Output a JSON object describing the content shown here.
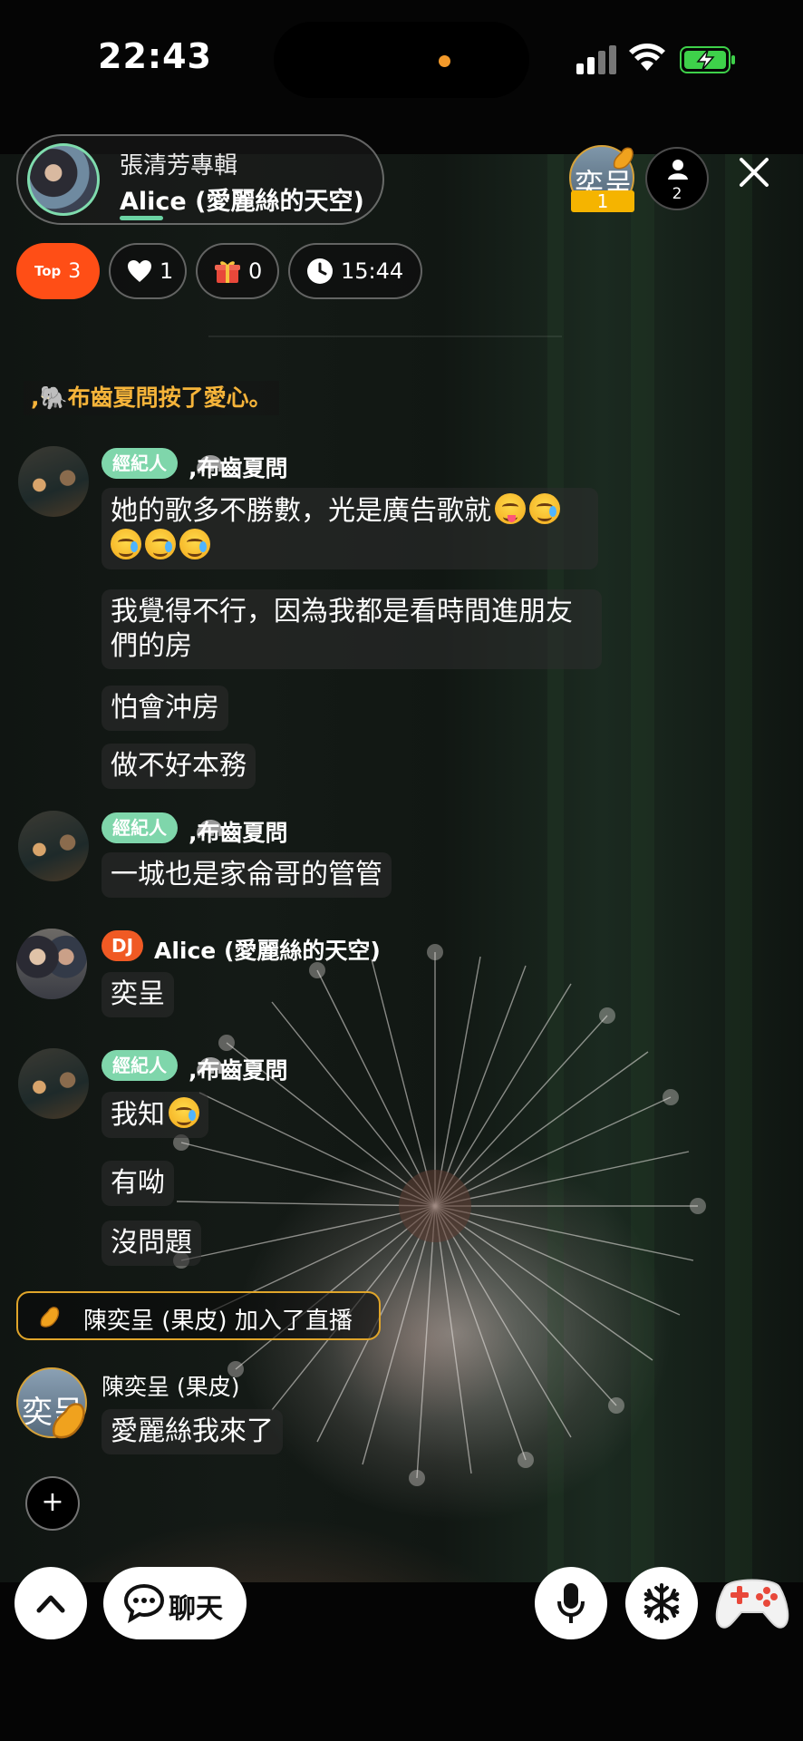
{
  "status_bar": {
    "time": "22:43"
  },
  "host": {
    "title": "張清芳專輯",
    "name": "Alice (愛麗絲的天空)"
  },
  "top_right": {
    "rank_badge_char": "奕呈",
    "rank_number": "1",
    "viewer_count": "2"
  },
  "stats": {
    "top_label": "Top",
    "top_value": "3",
    "likes": "1",
    "gifts": "0",
    "duration": "15:44"
  },
  "chat": {
    "system_like": ",🐘布齒夏問按了愛心。",
    "agent_tag": "經紀人",
    "dj_tag": "DJ",
    "agent_name": ",布齒夏問",
    "host_name": "Alice (愛麗絲的天空)",
    "msg1": "她的歌多不勝數，光是廣告歌就",
    "msg2": "我覺得不行，因為我都是看時間進朋友們的房",
    "msg3": "怕會沖房",
    "msg4": "做不好本務",
    "msg5": "一城也是家侖哥的管管",
    "msg6": "奕呈",
    "msg7": "我知",
    "msg8": "有呦",
    "msg9": "沒問題",
    "join_text": "陳奕呈 (果皮) 加入了直播",
    "yi_name": "陳奕呈 (果皮)",
    "yi_avatar_char": "奕呈",
    "msg10": "愛麗絲我來了"
  },
  "controls": {
    "plus": "+",
    "chat_label": "聊天"
  },
  "icons": {
    "signal": "signal-icon",
    "wifi": "wifi-icon",
    "battery": "battery-charging-icon",
    "close": "close-icon",
    "person": "person-icon",
    "heart": "heart-icon",
    "gift": "gift-icon",
    "clock": "clock-icon",
    "chevron_up": "chevron-up-icon",
    "chat_bubble": "chat-bubble-icon",
    "mic": "mic-icon",
    "snowflake": "snowflake-icon",
    "gamepad": "gamepad-icon"
  },
  "colors": {
    "accent_green": "#7fd6ab",
    "top_orange": "#ff4e16",
    "system_text": "#f6b43a",
    "join_border": "#e0a52a",
    "dj_orange": "#f05a24"
  }
}
